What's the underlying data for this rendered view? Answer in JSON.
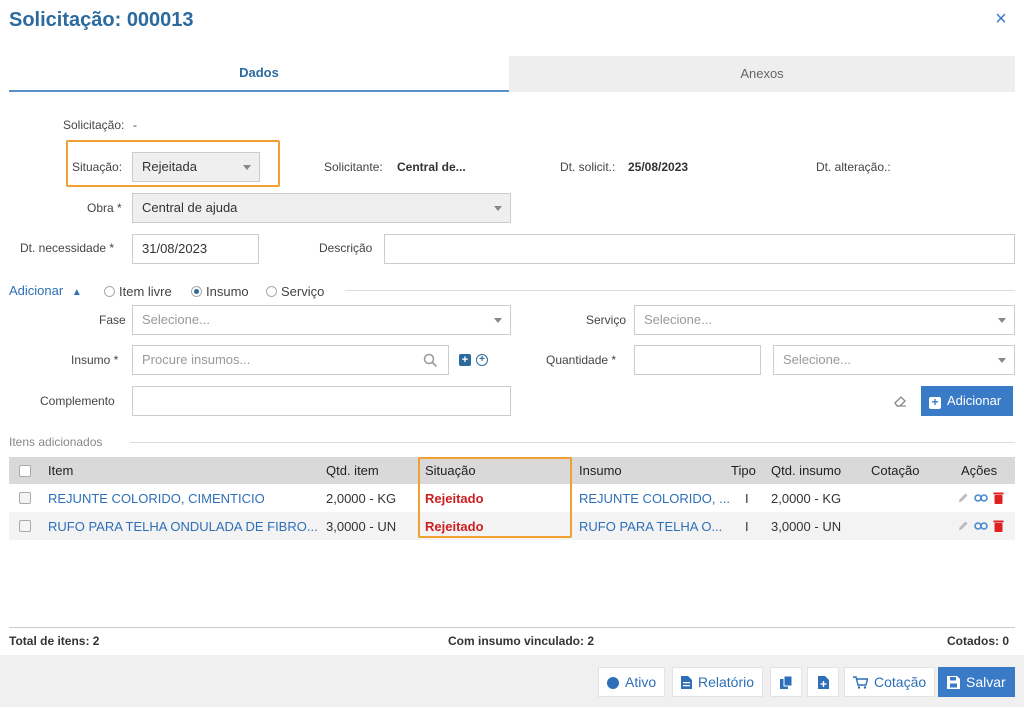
{
  "header": {
    "title": "Solicitação: 000013",
    "close_icon": "×"
  },
  "tabs": [
    {
      "label": "Dados",
      "active": true
    },
    {
      "label": "Anexos",
      "active": false
    }
  ],
  "form": {
    "solicitacao_label": "Solicitação:",
    "solicitacao_value": "-",
    "situacao_label": "Situação:",
    "situacao_value": "Rejeitada",
    "solicitante_label": "Solicitante:",
    "solicitante_value": "Central de...",
    "dt_solicit_label": "Dt. solicit.:",
    "dt_solicit_value": "25/08/2023",
    "dt_alteracao_label": "Dt. alteração.:",
    "obra_label": "Obra *",
    "obra_value": "Central de ajuda",
    "dt_necessidade_label": "Dt. necessidade *",
    "dt_necessidade_value": "31/08/2023",
    "descricao_label": "Descrição"
  },
  "adicionar": {
    "toggle_label": "Adicionar",
    "options": [
      "Item livre",
      "Insumo",
      "Serviço"
    ],
    "selected_index": 1,
    "fase_label": "Fase",
    "fase_placeholder": "Selecione...",
    "servico_label": "Serviço",
    "servico_placeholder": "Selecione...",
    "insumo_label": "Insumo *",
    "insumo_placeholder": "Procure insumos...",
    "quantidade_label": "Quantidade *",
    "unidade_placeholder": "Selecione...",
    "complemento_label": "Complemento",
    "add_button_label": "Adicionar"
  },
  "itens": {
    "section_label": "Itens adicionados",
    "columns": [
      "Item",
      "Qtd. item",
      "Situação",
      "Insumo",
      "Tipo",
      "Qtd. insumo",
      "Cotação",
      "Ações"
    ],
    "rows": [
      {
        "item": "REJUNTE COLORIDO, CIMENTICIO",
        "qtd_item": "2,0000 - KG",
        "situacao": "Rejeitado",
        "insumo": "REJUNTE COLORIDO, ...",
        "tipo": "I",
        "qtd_insumo": "2,0000 - KG",
        "cotacao": ""
      },
      {
        "item": "RUFO PARA TELHA ONDULADA DE FIBRO...",
        "qtd_item": "3,0000 - UN",
        "situacao": "Rejeitado",
        "insumo": "RUFO PARA TELHA O...",
        "tipo": "I",
        "qtd_insumo": "3,0000 - UN",
        "cotacao": ""
      }
    ]
  },
  "footer": {
    "total_itens": "Total de itens: 2",
    "com_insumo": "Com insumo vinculado: 2",
    "cotados": "Cotados: 0"
  },
  "actions": {
    "ativo": "Ativo",
    "relatorio": "Relatório",
    "cotacao": "Cotação",
    "salvar": "Salvar"
  },
  "colors": {
    "primary": "#3a7bc8",
    "title": "#2b6a9e",
    "highlight": "#f0a030",
    "rejected": "#cc1f1f",
    "link": "#2e6fb8"
  }
}
